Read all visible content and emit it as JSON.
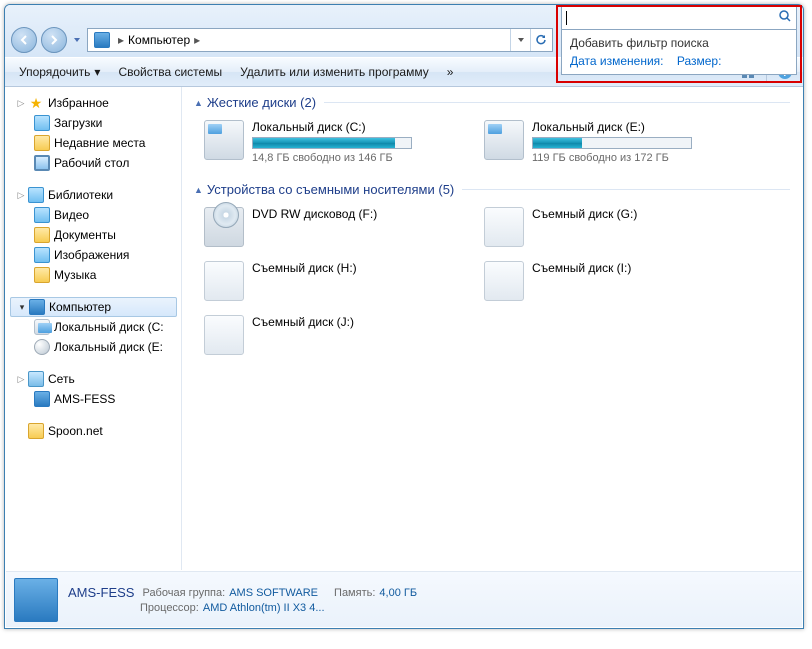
{
  "titlebar": {},
  "address": {
    "location": "Компьютер"
  },
  "search": {
    "placeholder": "",
    "drophdr": "Добавить фильтр поиска",
    "filter_date": "Дата изменения:",
    "filter_size": "Размер:"
  },
  "toolbar": {
    "organize": "Упорядочить",
    "system_props": "Свойства системы",
    "add_remove": "Удалить или изменить программу",
    "more": "»"
  },
  "sidebar": {
    "favorites": "Избранное",
    "downloads": "Загрузки",
    "recent": "Недавние места",
    "desktop": "Рабочий стол",
    "libraries": "Библиотеки",
    "videos": "Видео",
    "documents": "Документы",
    "pictures": "Изображения",
    "music": "Музыка",
    "computer": "Компьютер",
    "localC": "Локальный диск (C:",
    "localE": "Локальный диск (E:",
    "network": "Сеть",
    "host": "AMS-FESS",
    "spoon": "Spoon.net"
  },
  "groups": {
    "hdd_title": "Жесткие диски (2)",
    "removable_title": "Устройства со съемными носителями (5)"
  },
  "drives": {
    "c_name": "Локальный диск (C:)",
    "c_free": "14,8 ГБ свободно из 146 ГБ",
    "c_fill_pct": 90,
    "e_name": "Локальный диск (E:)",
    "e_free": "119 ГБ свободно из 172 ГБ",
    "e_fill_pct": 31,
    "dvd_name": "DVD RW дисковод (F:)",
    "g_name": "Съемный диск (G:)",
    "h_name": "Съемный диск (H:)",
    "i_name": "Съемный диск (I:)",
    "j_name": "Съемный диск (J:)"
  },
  "details": {
    "name": "AMS-FESS",
    "workgroup_lbl": "Рабочая группа:",
    "workgroup_val": "AMS SOFTWARE",
    "mem_lbl": "Память:",
    "mem_val": "4,00 ГБ",
    "cpu_lbl": "Процессор:",
    "cpu_val": "AMD Athlon(tm) II X3 4..."
  }
}
